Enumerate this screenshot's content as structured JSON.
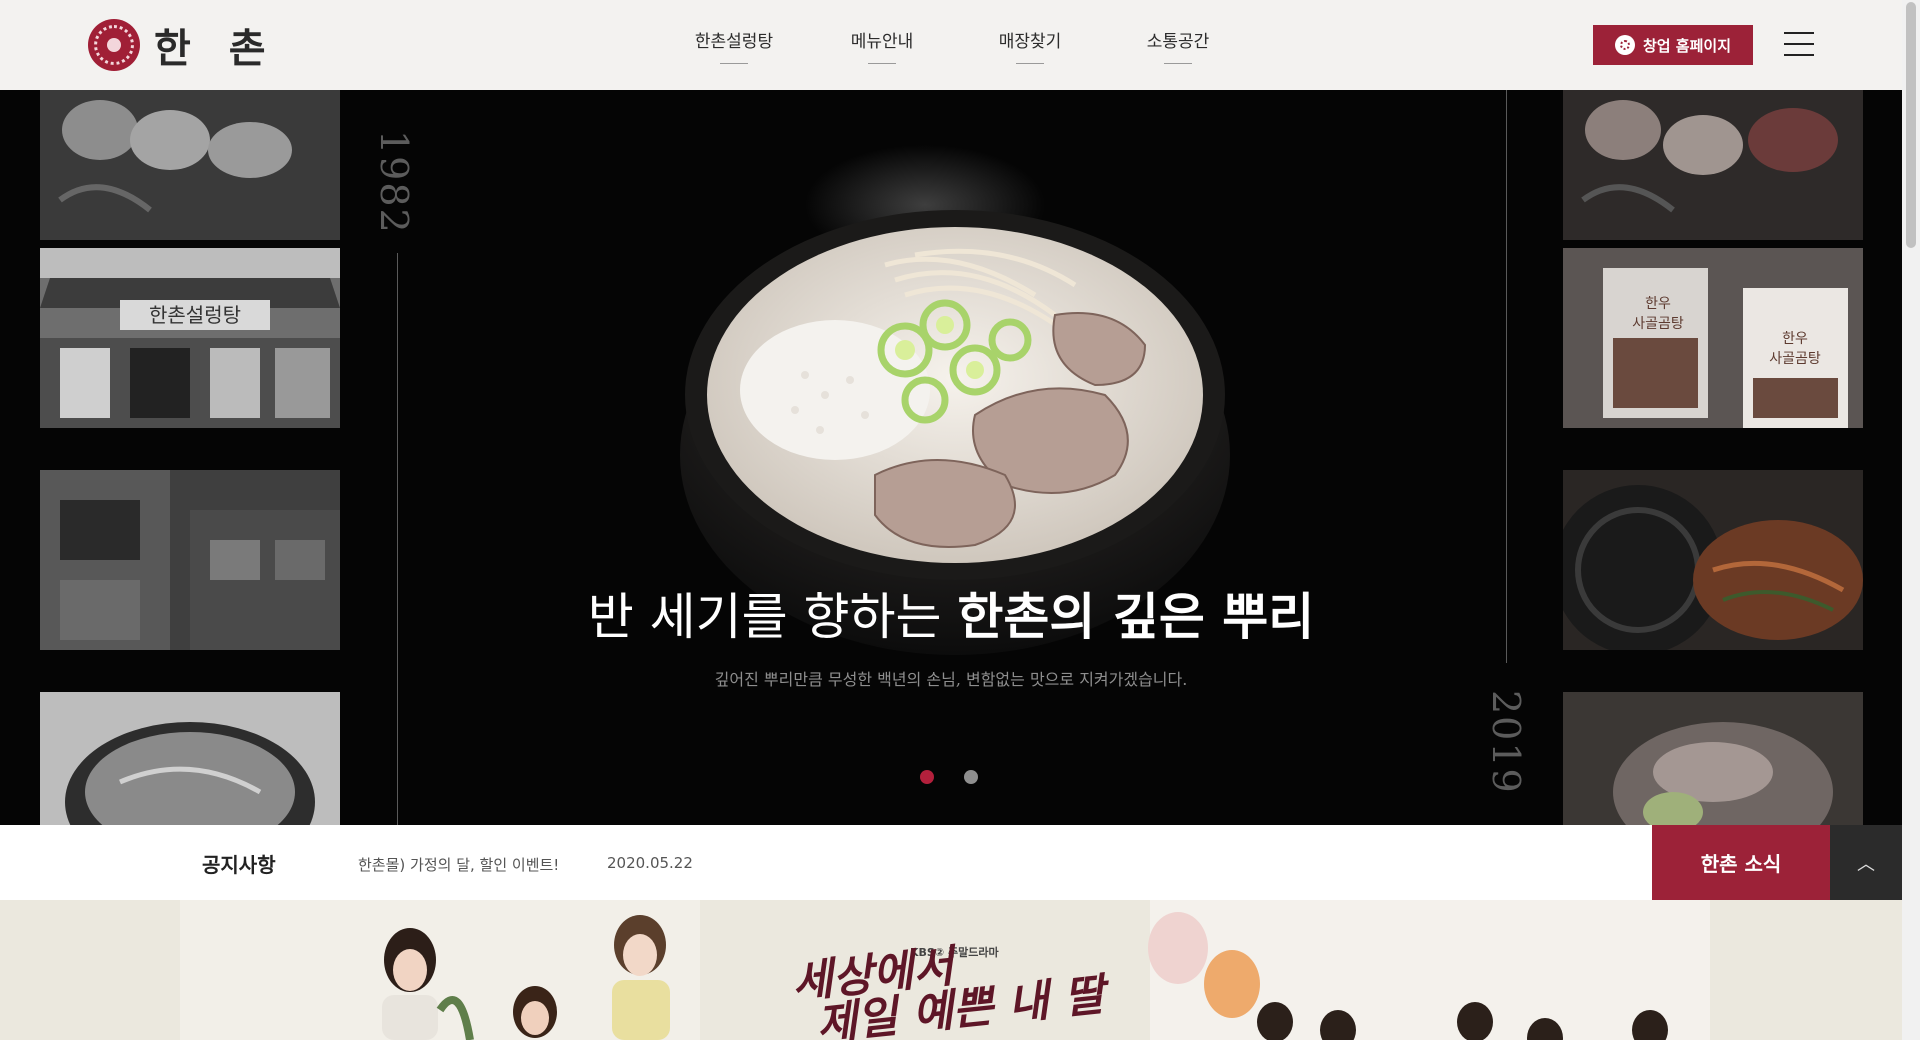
{
  "header": {
    "logo_text": "한 촌",
    "nav": [
      "한촌설렁탕",
      "메뉴안내",
      "매장찾기",
      "소통공간"
    ],
    "startup_button": "창업 홈페이지"
  },
  "hero": {
    "year_left": "1982",
    "year_right": "2019",
    "title_light": "반 세기를 향하는 ",
    "title_bold": "한촌의 깊은 뿌리",
    "subtitle": "깊어진 뿌리만큼 무성한 백년의 손님, 변함없는 맛으로 지켜가겠습니다.",
    "slide_count": 2,
    "active_slide": 1
  },
  "notice": {
    "label": "공지사항",
    "text": "한촌몰) 가정의 달, 할인 이벤트!",
    "date": "2020.05.22",
    "news_button": "한촌 소식",
    "top_button": "︿"
  },
  "banner": {
    "broadcaster": "KBS② 주말드라마",
    "drama_title_line1": "세상에서",
    "drama_title_line2": "제일 예쁜 내 딸"
  },
  "colors": {
    "brand": "#9c2238",
    "header_bg": "#f3f2f0",
    "hero_bg": "#050505"
  }
}
